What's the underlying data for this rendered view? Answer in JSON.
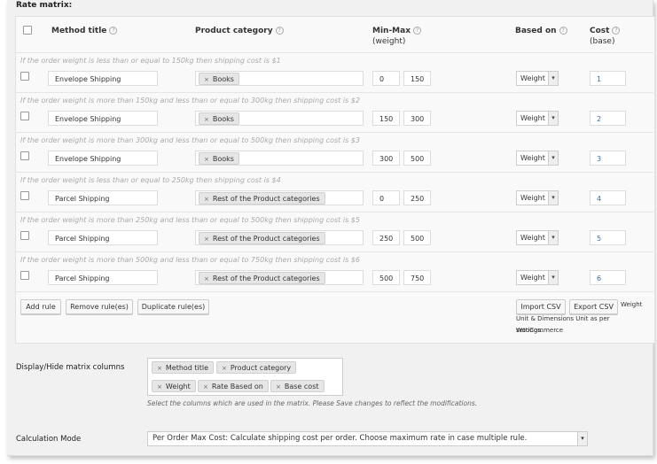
{
  "matrix_title": "Rate matrix:",
  "headers": {
    "method_title": "Method title",
    "product_category": "Product category",
    "min_max": "Min-Max",
    "min_max_sub": "(weight)",
    "based_on": "Based on",
    "cost": "Cost",
    "cost_sub": "(base)"
  },
  "help_glyph": "?",
  "rows": [
    {
      "desc": "If the order weight is less than or equal to 150kg then shipping cost is $1",
      "method": "Envelope Shipping",
      "category": "Books",
      "min": "0",
      "max": "150",
      "based_on": "Weight",
      "cost": "1"
    },
    {
      "desc": "If the order weight is more than 150kg and less than or equal to 300kg then shipping cost is $2",
      "method": "Envelope Shipping",
      "category": "Books",
      "min": "150",
      "max": "300",
      "based_on": "Weight",
      "cost": "2"
    },
    {
      "desc": "If the order weight is more than 300kg and less than or equal to 500kg then shipping cost is $3",
      "method": "Envelope Shipping",
      "category": "Books",
      "min": "300",
      "max": "500",
      "based_on": "Weight",
      "cost": "3"
    },
    {
      "desc": "If the order weight is less than or equal to 250kg then shipping cost is $4",
      "method": "Parcel Shipping",
      "category": "Rest of the Product categories",
      "min": "0",
      "max": "250",
      "based_on": "Weight",
      "cost": "4"
    },
    {
      "desc": "If the order weight is more than 250kg and less than or equal to 500kg then shipping cost is $5",
      "method": "Parcel Shipping",
      "category": "Rest of the Product categories",
      "min": "250",
      "max": "500",
      "based_on": "Weight",
      "cost": "5"
    },
    {
      "desc": "If the order weight is more than 500kg and less than or equal to 750kg then shipping cost is $6",
      "method": "Parcel Shipping",
      "category": "Rest of the Product categories",
      "min": "500",
      "max": "750",
      "based_on": "Weight",
      "cost": "6"
    }
  ],
  "buttons": {
    "add_rule": "Add rule",
    "remove_rules": "Remove rule(es)",
    "duplicate_rules": "Duplicate rule(es)",
    "import_csv": "Import CSV",
    "export_csv": "Export CSV"
  },
  "units_note": {
    "line1": "Weight",
    "line2": "Unit & Dimensions Unit as per WooCommerce",
    "line3": "settings."
  },
  "display_hide": {
    "label": "Display/Hide matrix columns",
    "tags": [
      "Method title",
      "Product category",
      "Weight",
      "Rate Based on",
      "Base cost"
    ],
    "hint": "Select the columns which are used in the matrix. Please Save changes to reflect the modifications."
  },
  "calculation_mode": {
    "label": "Calculation Mode",
    "value": "Per Order Max Cost: Calculate shipping cost per order. Choose maximum rate in case multiple rule."
  },
  "icons": {
    "tag_remove": "×",
    "dropdown_arrow": "▾",
    "help": "help-circle-icon"
  }
}
